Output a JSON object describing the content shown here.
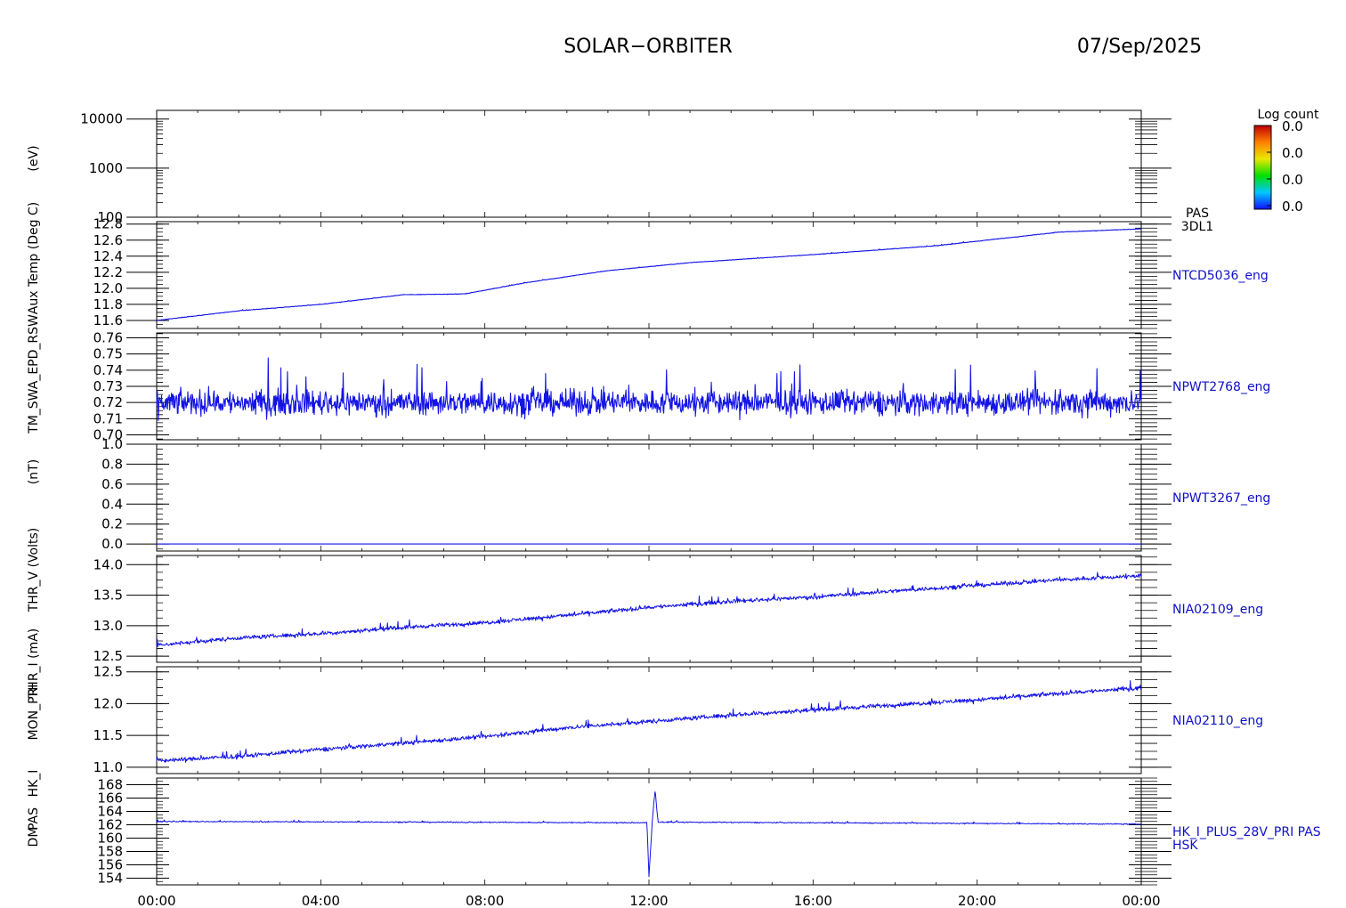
{
  "header": {
    "mission": "SOLAR−ORBITER",
    "date": "07/Sep/2025"
  },
  "colorbar": {
    "title": "Log count",
    "ticks": [
      "0.0",
      "0.0",
      "0.0",
      "0.0"
    ]
  },
  "y_axis_labels": [
    "(eV)",
    "Aux Temp (Deg C)",
    "TM_SWA_EPD_RSW",
    "(nT)",
    "THR_V (Volts)",
    "THR_I (mA)",
    "MON_PRI",
    "HK_I",
    "PAS",
    "DM"
  ],
  "chart_data": {
    "type": "line",
    "x_axis": {
      "tick_labels": [
        "00:00",
        "04:00",
        "08:00",
        "12:00",
        "16:00",
        "20:00",
        "00:00"
      ],
      "xlim_hours": [
        0,
        24
      ]
    },
    "panels": [
      {
        "name": "PAS 3DL1",
        "label_lines": [
          "PAS",
          "3DL1"
        ],
        "type": "heatmap",
        "log": true,
        "ylim": [
          100,
          15000
        ],
        "tick_values": [
          100,
          1000,
          10000
        ],
        "tick_labels": [
          "100",
          "1000",
          "10000"
        ],
        "series": []
      },
      {
        "name": "NTCD5036_eng",
        "label_lines": [
          "NTCD5036_eng"
        ],
        "ylim": [
          11.5,
          12.83
        ],
        "tick_values": [
          11.6,
          11.8,
          12.0,
          12.2,
          12.4,
          12.6,
          12.8
        ],
        "tick_labels": [
          "11.6",
          "11.8",
          "12.0",
          "12.2",
          "12.4",
          "12.6",
          "12.8"
        ],
        "noise": 0.005,
        "series": [
          {
            "x": [
              0,
              2,
              4,
              6,
              7.5,
              9,
              11,
              13,
              16,
              19,
              22,
              24
            ],
            "y": [
              11.6,
              11.72,
              11.8,
              11.92,
              11.93,
              12.07,
              12.22,
              12.32,
              12.42,
              12.53,
              12.7,
              12.74
            ]
          }
        ]
      },
      {
        "name": "NPWT2768_eng",
        "label_lines": [
          "NPWT2768_eng"
        ],
        "ylim": [
          0.697,
          0.763
        ],
        "tick_values": [
          0.7,
          0.71,
          0.72,
          0.73,
          0.74,
          0.75,
          0.76
        ],
        "tick_labels": [
          "0.70",
          "0.71",
          "0.72",
          "0.73",
          "0.74",
          "0.75",
          "0.76"
        ],
        "noise": 0.011,
        "series": [
          {
            "x": [
              0,
              24
            ],
            "y": [
              0.72,
              0.72
            ]
          }
        ]
      },
      {
        "name": "NPWT3267_eng",
        "label_lines": [
          "NPWT3267_eng"
        ],
        "ylim": [
          -0.07,
          1.0
        ],
        "tick_values": [
          0.0,
          0.2,
          0.4,
          0.6,
          0.8,
          1.0
        ],
        "tick_labels": [
          "0.0",
          "0.2",
          "0.4",
          "0.6",
          "0.8",
          "1.0"
        ],
        "noise": 0.0,
        "series": [
          {
            "x": [
              0,
              24
            ],
            "y": [
              0.0,
              0.0
            ]
          }
        ]
      },
      {
        "name": "NIA02109_eng",
        "label_lines": [
          "NIA02109_eng"
        ],
        "ylim": [
          12.4,
          14.15
        ],
        "tick_values": [
          12.5,
          13.0,
          13.5,
          14.0
        ],
        "tick_labels": [
          "12.5",
          "13.0",
          "13.5",
          "14.0"
        ],
        "noise": 0.05,
        "series": [
          {
            "x": [
              0,
              2,
              4,
              6,
              8,
              10,
              12,
              14,
              16,
              18,
              20,
              22,
              24
            ],
            "y": [
              12.68,
              12.8,
              12.87,
              12.97,
              13.05,
              13.17,
              13.3,
              13.4,
              13.47,
              13.57,
              13.66,
              13.75,
              13.82
            ]
          }
        ]
      },
      {
        "name": "NIA02110_eng",
        "label_lines": [
          "NIA02110_eng"
        ],
        "ylim": [
          10.9,
          12.58
        ],
        "tick_values": [
          11.0,
          11.5,
          12.0,
          12.5
        ],
        "tick_labels": [
          "11.0",
          "11.5",
          "12.0",
          "12.5"
        ],
        "noise": 0.05,
        "series": [
          {
            "x": [
              0,
              2,
              4,
              6,
              8,
              10,
              12,
              14,
              16,
              18,
              20,
              22,
              24
            ],
            "y": [
              11.1,
              11.17,
              11.28,
              11.38,
              11.48,
              11.62,
              11.72,
              11.82,
              11.9,
              11.98,
              12.06,
              12.16,
              12.25
            ]
          }
        ]
      },
      {
        "name": "HK_I_PLUS_28V_PRI PAS HSK",
        "label_lines": [
          "HK_I_PLUS_28V_PRI PAS",
          "HSK"
        ],
        "ylim": [
          153,
          169
        ],
        "tick_values": [
          154,
          156,
          158,
          160,
          162,
          164,
          166,
          168
        ],
        "tick_labels": [
          "154",
          "156",
          "158",
          "160",
          "162",
          "164",
          "166",
          "168"
        ],
        "noise": 0.12,
        "series": [
          {
            "x": [
              0,
              11.95,
              12.0,
              12.08,
              12.15,
              12.22,
              24
            ],
            "y": [
              162.5,
              162.3,
              154.2,
              162.5,
              167.2,
              162.4,
              162.1
            ]
          }
        ]
      }
    ]
  }
}
